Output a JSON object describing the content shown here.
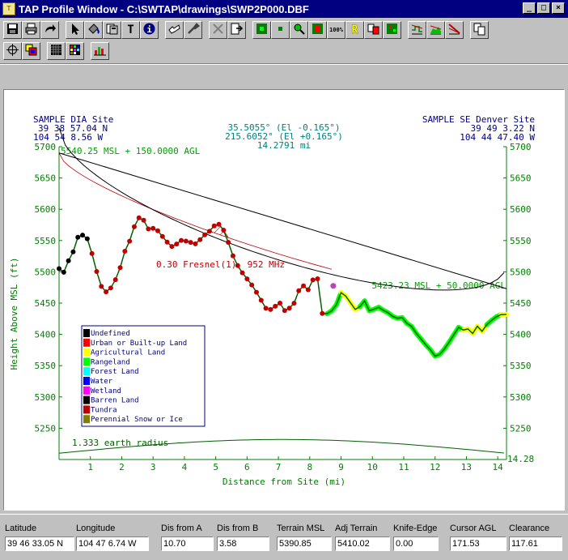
{
  "window": {
    "title": "TAP Profile Window - C:\\SWTAP\\drawings\\SWP2P000.DBF",
    "icon": "tap-app-icon",
    "controls": [
      "minimize",
      "maximize",
      "close"
    ]
  },
  "toolbar": {
    "row1": [
      {
        "name": "save-icon"
      },
      {
        "name": "print-icon"
      },
      {
        "name": "redo-arrow-icon"
      },
      {
        "sep": true
      },
      {
        "name": "pointer-icon"
      },
      {
        "name": "paint-bucket-icon"
      },
      {
        "name": "layers-icon"
      },
      {
        "name": "text-icon",
        "label": "T"
      },
      {
        "name": "info-icon"
      },
      {
        "sep": true
      },
      {
        "name": "pan-icon"
      },
      {
        "name": "wrench-icon"
      },
      {
        "sep": true
      },
      {
        "name": "cut-icon"
      },
      {
        "name": "export-icon"
      },
      {
        "sep": true
      },
      {
        "name": "green-marker-icon"
      },
      {
        "name": "green-square-icon"
      },
      {
        "name": "green-magnify-icon"
      },
      {
        "name": "red-marker-icon"
      },
      {
        "name": "zoom-100-icon",
        "label": "100%"
      },
      {
        "name": "letter-r-icon",
        "label": "R"
      },
      {
        "name": "swap-red-icon"
      },
      {
        "name": "green-grid-icon"
      },
      {
        "sep": true
      },
      {
        "name": "step-chart-icon"
      },
      {
        "name": "area-chart-icon"
      },
      {
        "name": "diagonal-chart-icon"
      },
      {
        "sep": true
      },
      {
        "name": "copy-icon"
      }
    ],
    "row2": [
      {
        "name": "crosshair-icon"
      },
      {
        "name": "color-layers-icon"
      },
      {
        "sep": true
      },
      {
        "name": "grid-icon"
      },
      {
        "name": "color-grid-icon"
      },
      {
        "sep": true
      },
      {
        "name": "bar-chart-icon"
      }
    ]
  },
  "chart_data": {
    "type": "line",
    "site_a": {
      "name": "SAMPLE DIA Site",
      "lat": "39 38 57.04 N",
      "lon": "104 54 8.56 W"
    },
    "site_b": {
      "name": "SAMPLE SE Denver Site",
      "lat": "39 49 3.22 N",
      "lon": "104 44 47.40 W"
    },
    "azimuth_a": "35.5055° (El -0.165°)",
    "azimuth_b": "215.6052° (El +0.165°)",
    "distance": "14.2791 mi",
    "antenna_a": "5540.25 MSL + 150.0000 AGL",
    "antenna_b": "5423.23 MSL + 50.0000 AGL",
    "fresnel_label": "0.30 Fresnel(1), 952 MHz",
    "earth_label": "1.333 earth radius",
    "end_distance_label": "14.28",
    "xlabel": "Distance from Site (mi)",
    "ylabel": "Height Above MSL (ft)",
    "xlim": [
      0,
      14.28
    ],
    "ylim": [
      5200,
      5700
    ],
    "x_ticks": [
      "1",
      "2",
      "3",
      "4",
      "5",
      "6",
      "7",
      "8",
      "9",
      "10",
      "11",
      "12",
      "13",
      "14"
    ],
    "y_ticks": [
      "5250",
      "5300",
      "5350",
      "5400",
      "5450",
      "5500",
      "5550",
      "5600",
      "5650",
      "5700"
    ],
    "terrain": {
      "x": [
        0,
        0.15,
        0.3,
        0.45,
        0.6,
        0.75,
        0.9,
        1.05,
        1.2,
        1.35,
        1.5,
        1.65,
        1.8,
        1.95,
        2.1,
        2.25,
        2.4,
        2.55,
        2.7,
        2.85,
        3.0,
        3.15,
        3.3,
        3.45,
        3.6,
        3.75,
        3.9,
        4.05,
        4.2,
        4.35,
        4.5,
        4.65,
        4.8,
        4.95,
        5.1,
        5.25,
        5.4,
        5.55,
        5.7,
        5.85,
        6.0,
        6.15,
        6.3,
        6.45,
        6.6,
        6.75,
        6.9,
        7.05,
        7.2,
        7.35,
        7.5,
        7.65,
        7.8,
        7.95,
        8.1,
        8.25,
        8.4,
        8.55,
        8.7,
        8.85,
        9.0,
        9.15,
        9.3,
        9.45,
        9.6,
        9.75,
        9.9,
        10.05,
        10.2,
        10.35,
        10.5,
        10.65,
        10.8,
        10.95,
        11.1,
        11.25,
        11.4,
        11.55,
        11.7,
        11.85,
        12.0,
        12.15,
        12.3,
        12.45,
        12.6,
        12.75,
        12.9,
        13.05,
        13.2,
        13.35,
        13.5,
        13.65,
        13.8,
        13.95,
        14.1,
        14.28
      ],
      "y": [
        5505,
        5498,
        5515,
        5528,
        5550,
        5552,
        5545,
        5520,
        5490,
        5465,
        5455,
        5460,
        5472,
        5490,
        5515,
        5530,
        5552,
        5565,
        5560,
        5545,
        5545,
        5540,
        5530,
        5520,
        5512,
        5515,
        5520,
        5518,
        5515,
        5512,
        5518,
        5525,
        5530,
        5538,
        5540,
        5530,
        5510,
        5488,
        5472,
        5460,
        5450,
        5440,
        5428,
        5415,
        5402,
        5400,
        5405,
        5410,
        5398,
        5402,
        5410,
        5430,
        5438,
        5432,
        5448,
        5450,
        5395,
        5395,
        5400,
        5410,
        5430,
        5425,
        5415,
        5405,
        5410,
        5420,
        5405,
        5408,
        5412,
        5408,
        5405,
        5400,
        5398,
        5400,
        5392,
        5388,
        5378,
        5370,
        5362,
        5355,
        5346,
        5350,
        5360,
        5372,
        5385,
        5398,
        5395,
        5398,
        5392,
        5405,
        5398,
        5410,
        5418,
        5425,
        5430,
        5432
      ]
    },
    "clutter_legend": [
      {
        "label": "Undefined",
        "color": "#000000"
      },
      {
        "label": "Urban or Built-up Land",
        "color": "#ff0000"
      },
      {
        "label": "Agricultural Land",
        "color": "#ffff00"
      },
      {
        "label": "Rangeland",
        "color": "#00ff00"
      },
      {
        "label": "Forest Land",
        "color": "#00ffff"
      },
      {
        "label": "Water",
        "color": "#0000ff"
      },
      {
        "label": "Wetland",
        "color": "#ff00ff"
      },
      {
        "label": "Barren Land",
        "color": "#000000"
      },
      {
        "label": "Tundra",
        "color": "#c00000"
      },
      {
        "label": "Perennial Snow or Ice",
        "color": "#808000"
      }
    ],
    "colors": {
      "axes": "#008000",
      "site_text": "#000080",
      "az_text": "#008080",
      "fresnel": "#c00000",
      "path": "#000000",
      "earth": "#006000"
    }
  },
  "status": [
    {
      "label": "Latitude",
      "value": "39 46 33.05 N"
    },
    {
      "label": "Longitude",
      "value": "104 47 6.74 W"
    },
    {
      "label": "Dis from A",
      "value": "10.70"
    },
    {
      "label": "Dis from B",
      "value": "3.58"
    },
    {
      "label": "Terrain MSL",
      "value": "5390.85"
    },
    {
      "label": "Adj Terrain",
      "value": "5410.02"
    },
    {
      "label": "Knife-Edge",
      "value": "0.00"
    },
    {
      "label": "Cursor AGL",
      "value": "171.53"
    },
    {
      "label": "Clearance",
      "value": "117.61"
    }
  ]
}
